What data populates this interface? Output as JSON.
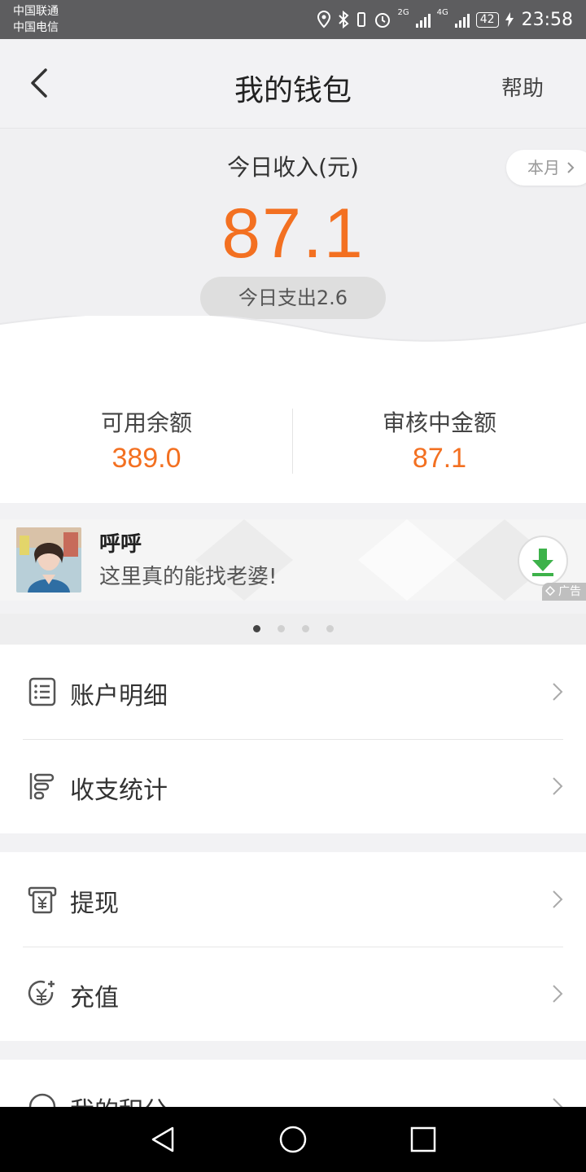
{
  "status": {
    "carrier1": "中国联通",
    "carrier2": "中国电信",
    "net1": "2G",
    "net2": "4G",
    "battery": "42",
    "time": "23:58"
  },
  "header": {
    "title": "我的钱包",
    "help": "帮助"
  },
  "income": {
    "label": "今日收入(元)",
    "month_button": "本月",
    "amount": "87.1",
    "expense": "今日支出2.6"
  },
  "balances": {
    "available_label": "可用余额",
    "available_value": "389.0",
    "pending_label": "审核中金额",
    "pending_value": "87.1"
  },
  "ad": {
    "name": "呼呼",
    "text": "这里真的能找老婆!",
    "tag": "广告"
  },
  "carousel": {
    "count": 4,
    "active": 1
  },
  "menu": {
    "account_detail": "账户明细",
    "stats": "收支统计",
    "withdraw": "提现",
    "recharge": "充值",
    "points": "我的积分"
  },
  "colors": {
    "accent": "#f37021",
    "download": "#3db24a"
  }
}
